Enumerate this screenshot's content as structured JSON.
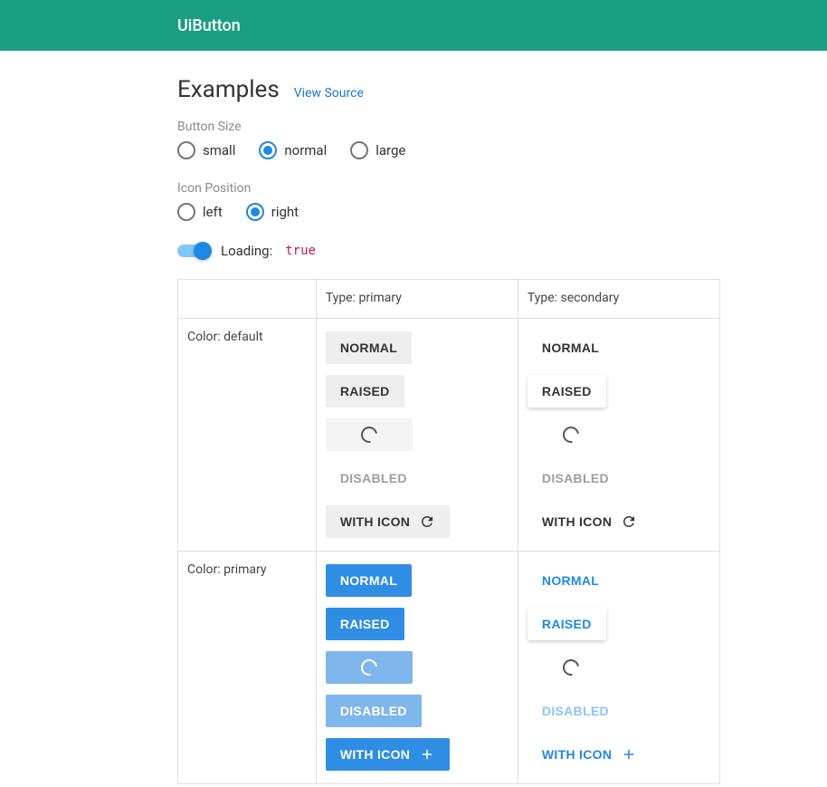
{
  "header": {
    "title": "UiButton"
  },
  "main": {
    "heading": "Examples",
    "source_link": "View Source",
    "sections": {
      "button_size": {
        "label": "Button Size",
        "options": [
          {
            "id": "small",
            "label": "small",
            "selected": false
          },
          {
            "id": "normal",
            "label": "normal",
            "selected": true
          },
          {
            "id": "large",
            "label": "large",
            "selected": false
          }
        ]
      },
      "icon_position": {
        "label": "Icon Position",
        "options": [
          {
            "id": "left",
            "label": "left",
            "selected": false
          },
          {
            "id": "right",
            "label": "right",
            "selected": true
          }
        ]
      },
      "loading": {
        "label": "Loading:",
        "value": "true",
        "on": true
      }
    },
    "table": {
      "columns": [
        {
          "header": "",
          "row_label_column": true
        },
        {
          "header": "Type: primary"
        },
        {
          "header": "Type: secondary"
        }
      ],
      "row_labels": [
        "Color: default",
        "Color: primary"
      ],
      "button_labels": {
        "normal": "NORMAL",
        "raised": "RAISED",
        "disabled": "DISABLED",
        "with_icon": "WITH ICON"
      },
      "icons": {
        "default_with_icon": "refresh-icon",
        "primary_with_icon": "plus-icon"
      }
    }
  },
  "colors": {
    "toolbar_bg": "#1a9e80",
    "primary": "#1e88e5",
    "primary_disabled": "#7fb6ec",
    "neutral_btn": "#eeeeee",
    "disabled_text": "#9e9e9e"
  }
}
